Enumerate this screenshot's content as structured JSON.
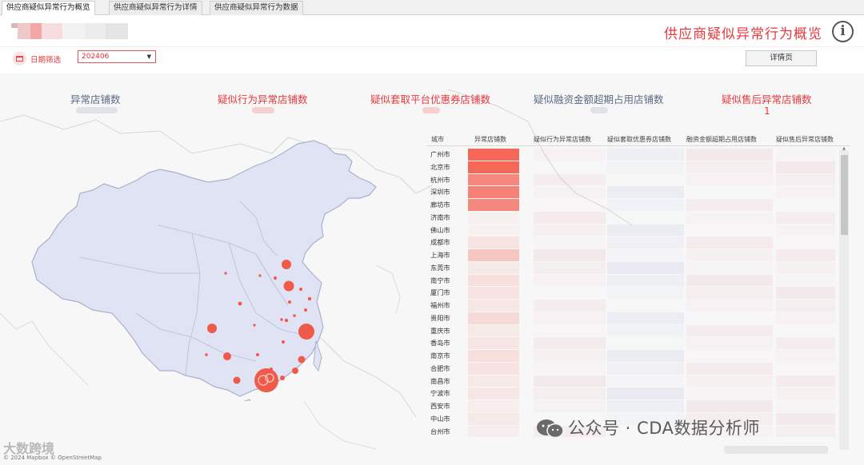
{
  "tabs": [
    {
      "label": "供应商疑似异常行为概览",
      "active": true
    },
    {
      "label": "供应商疑似异常行为详情",
      "active": false
    },
    {
      "label": "供应商疑似异常行为数据",
      "active": false
    }
  ],
  "header": {
    "title": "供应商疑似异常行为概览",
    "info_icon": "info-icon",
    "info_glyph": "i"
  },
  "filter": {
    "label": "日期筛选",
    "value": "202406",
    "caret": "▼",
    "icon": "calendar-icon"
  },
  "detail_button": "详情页",
  "kpis": [
    {
      "label": "异常店铺数",
      "value": ""
    },
    {
      "label": "疑似行为异常店铺数",
      "value": ""
    },
    {
      "label": "疑似套取平台优惠券店铺数",
      "value": ""
    },
    {
      "label": "疑似融资金额超期占用店铺数",
      "value": ""
    },
    {
      "label": "疑似售后异常店铺数",
      "value": "1"
    }
  ],
  "colors": {
    "accent": "#e5393f",
    "kpi_dark": "#5b6b85",
    "bubble": "#f05a4a",
    "map_fill": "#dfe3f4"
  },
  "table": {
    "columns": [
      "城市",
      "异常店铺数",
      "疑似行为异常店铺数",
      "疑似套取优惠券店铺数",
      "融资金额超期占用店铺数",
      "疑似售后异常店铺数"
    ],
    "cities": [
      "广州市",
      "北京市",
      "杭州市",
      "深圳市",
      "廊坊市",
      "济南市",
      "佛山市",
      "成都市",
      "上海市",
      "东莞市",
      "南宁市",
      "厦门市",
      "福州市",
      "贵阳市",
      "重庆市",
      "香岛市",
      "南京市",
      "合肥市",
      "南昌市",
      "宁波市",
      "西安市",
      "中山市",
      "台州市"
    ]
  },
  "watermark": {
    "text": "公众号 · CDA数据分析师",
    "icon": "wechat-icon"
  },
  "corner_logo": "大数跨境",
  "copyright": "© 2024 Mapbox © OpenStreetMap"
}
